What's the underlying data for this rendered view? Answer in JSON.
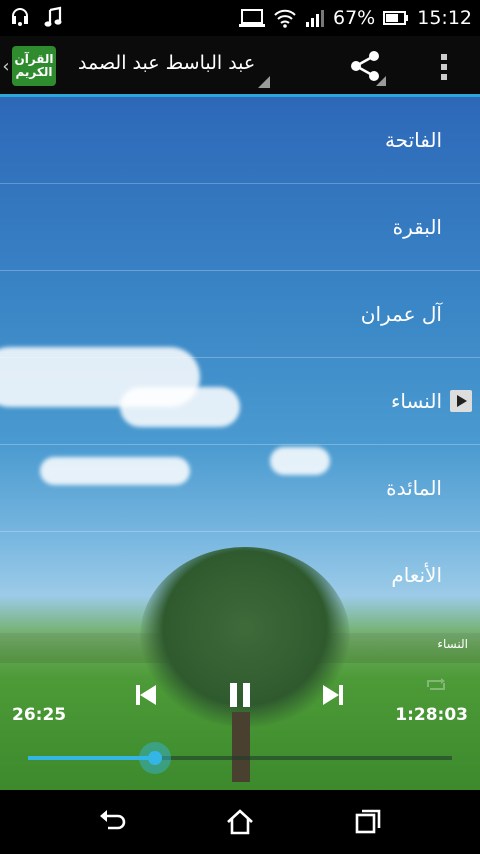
{
  "status_bar": {
    "icons": [
      "headset-notification-icon",
      "music-note-icon"
    ],
    "battery_percent": "67%",
    "time": "15:12",
    "right_icons": [
      "screen-cast-icon",
      "wifi-icon",
      "signal-icon",
      "battery-icon"
    ]
  },
  "action_bar": {
    "logo_text_line1": "القرآن",
    "logo_text_line2": "الكريم",
    "title": "عبد الباسط عبد الصمد",
    "share_icon": "share-icon",
    "overflow_icon": "overflow-menu-icon"
  },
  "surah_list": [
    {
      "label": "الفاتحة",
      "playing": false
    },
    {
      "label": "البقرة",
      "playing": false
    },
    {
      "label": "آل عمران",
      "playing": false
    },
    {
      "label": "النساء",
      "playing": true
    },
    {
      "label": "المائدة",
      "playing": false
    },
    {
      "label": "الأنعام",
      "playing": false
    }
  ],
  "player": {
    "now_playing": "النساء",
    "elapsed": "26:25",
    "duration": "1:28:03",
    "progress": 0.3,
    "controls": [
      "previous-icon",
      "pause-icon",
      "next-icon",
      "repeat-icon"
    ]
  },
  "colors": {
    "accent": "#33b5e5",
    "action_bar_underline": "#2ea7d8"
  },
  "nav_bar": [
    "back-icon",
    "home-icon",
    "recent-apps-icon"
  ]
}
